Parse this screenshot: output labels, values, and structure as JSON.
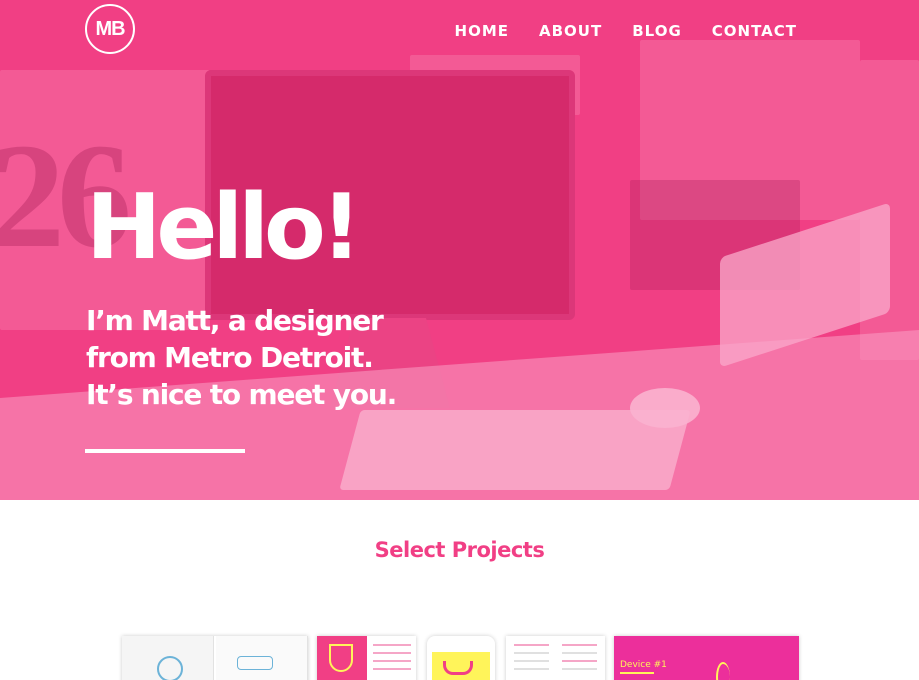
{
  "brand": {
    "logo_text": "MB",
    "accent_color": "#f13f85",
    "highlight_color": "#fff45a"
  },
  "nav": {
    "items": [
      {
        "label": "HOME"
      },
      {
        "label": "ABOUT"
      },
      {
        "label": "BLOG"
      },
      {
        "label": "CONTACT"
      }
    ]
  },
  "hero": {
    "headline": "Hello!",
    "intro_lines": [
      "I’m Matt, a designer",
      "from Metro Detroit.",
      "It’s nice to meet you."
    ]
  },
  "projects": {
    "title": "Select Projects",
    "thumbnails": [
      {
        "icon": "book-spread-icon"
      },
      {
        "icon": "shield-brochure-icon"
      },
      {
        "icon": "phone-app-icon"
      },
      {
        "icon": "document-icon"
      },
      {
        "label": "Device #1",
        "icon": "magazine-spread-icon"
      }
    ]
  }
}
